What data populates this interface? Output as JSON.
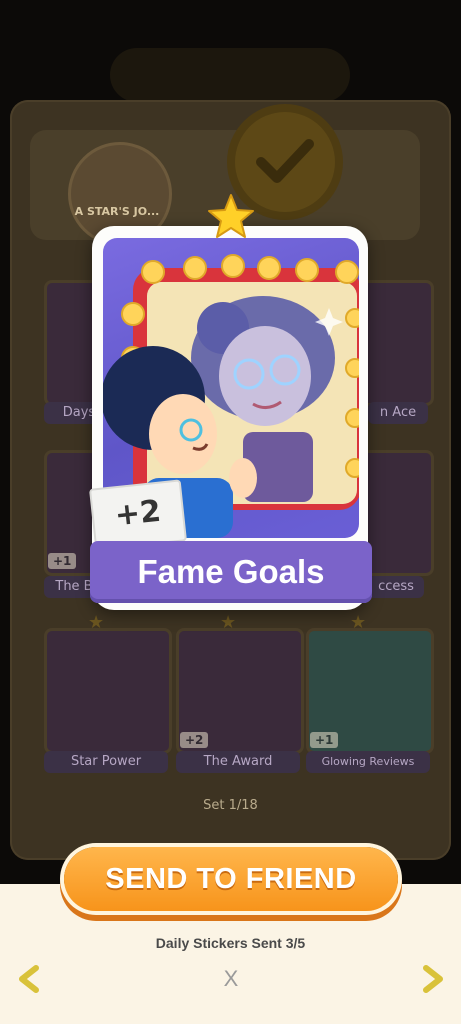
{
  "album": {
    "name": "A STAR'S JO...",
    "set_counter": "Set 1/18",
    "stickers": [
      {
        "label": "Days",
        "plus": ""
      },
      {
        "label": "n Ace",
        "plus": ""
      },
      {
        "label": "The B",
        "plus": "+1"
      },
      {
        "label": "ccess",
        "plus": ""
      },
      {
        "label": "Star Power",
        "plus": ""
      },
      {
        "label": "The Award",
        "plus": "+2"
      },
      {
        "label": "Glowing Reviews",
        "plus": "+1"
      }
    ]
  },
  "featured_sticker": {
    "name": "Fame Goals",
    "plus": "+2",
    "stars": 1
  },
  "actions": {
    "send_label": "SEND TO FRIEND",
    "daily_status": "Daily Stickers Sent 3/5",
    "close_label": "X"
  },
  "colors": {
    "accent_orange": "#f7941b",
    "banner_purple": "#7b63c9",
    "arrow_yellow": "#d9c23a"
  }
}
